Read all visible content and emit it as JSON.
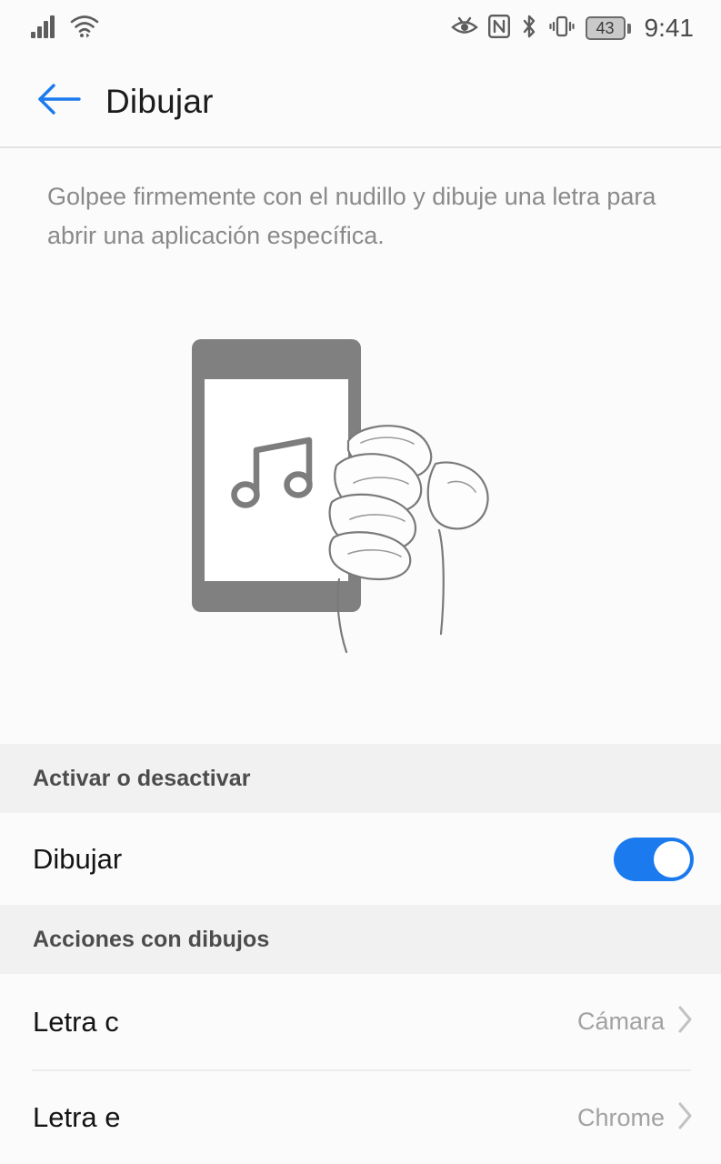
{
  "statusbar": {
    "time": "9:41",
    "battery_level": "43",
    "icons_left": [
      "signal-bars-icon",
      "wifi-icon"
    ],
    "icons_right": [
      "eye-comfort-icon",
      "nfc-icon",
      "bluetooth-icon",
      "vibrate-icon",
      "battery-icon"
    ]
  },
  "appbar": {
    "back_icon": "back-arrow-icon",
    "title": "Dibujar",
    "accent_color": "#1a7aee"
  },
  "description": "Golpee firmemente con el nudillo y dibuje una letra para abrir una aplicación específica.",
  "illustration": {
    "name": "knuckle-tap-phone-illustration",
    "screen_icon": "music-note-icon",
    "phone_color": "#808080",
    "outline_color": "#7a7a7a"
  },
  "sections": [
    {
      "header": "Activar o desactivar",
      "rows": [
        {
          "label": "Dibujar",
          "type": "toggle",
          "value": "",
          "checked": true
        }
      ]
    },
    {
      "header": "Acciones con dibujos",
      "rows": [
        {
          "label": "Letra c",
          "type": "navigation",
          "value": "Cámara",
          "chevron": "chevron-right-icon"
        },
        {
          "label": "Letra e",
          "type": "navigation",
          "value": "Chrome",
          "chevron": "chevron-right-icon"
        }
      ]
    }
  ],
  "colors": {
    "page_background": "#fbfbfb",
    "section_header_background": "#f1f1f1",
    "toggle_on": "#1a7aee",
    "primary_text": "#141414",
    "secondary_text": "#a2a2a2",
    "divider": "#ececec"
  }
}
